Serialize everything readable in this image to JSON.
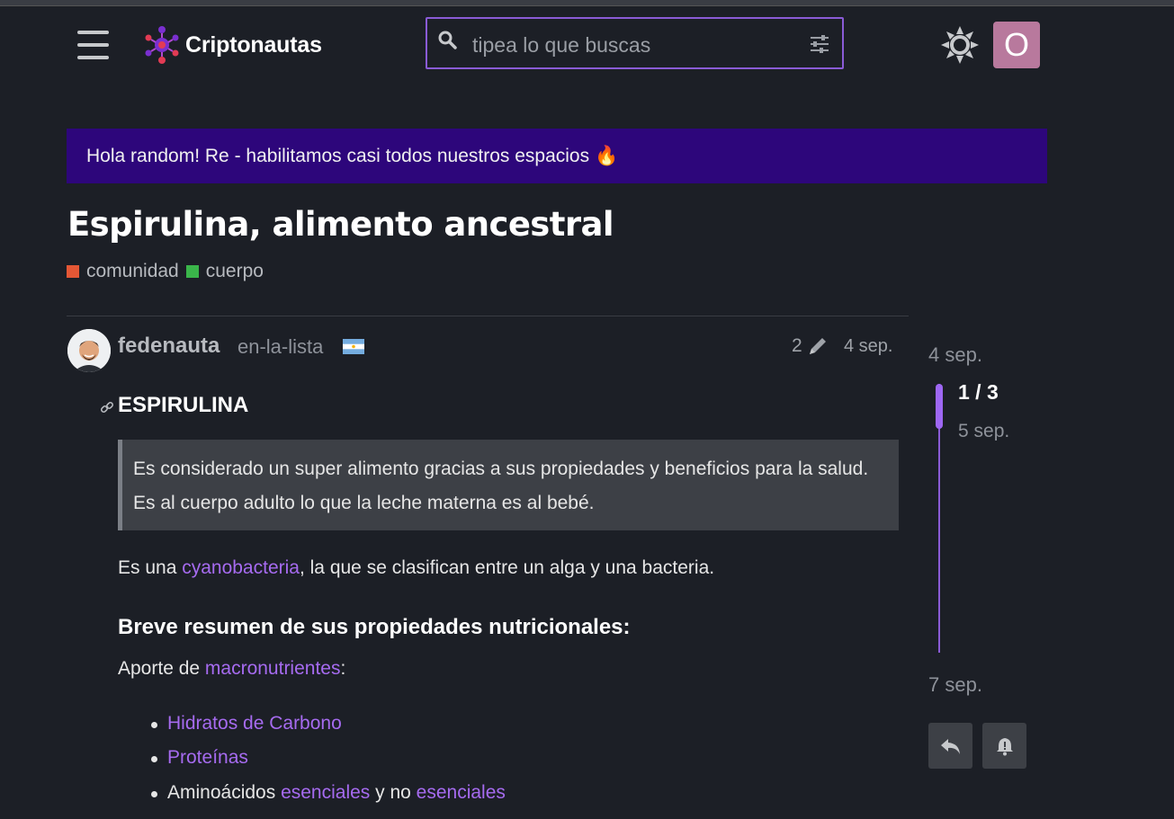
{
  "header": {
    "site_name": "Criptonautas",
    "search_placeholder": "tipea lo que buscas",
    "avatar_letter": "O",
    "avatar_color": "#b8799d",
    "accent_color": "#8a5bd6"
  },
  "banner": {
    "text": "Hola random! Re - habilitamos casi todos nuestros espacios 🔥",
    "background": "#2d067b"
  },
  "topic": {
    "title": "Espirulina, alimento ancestral",
    "categories": [
      {
        "label": "comunidad",
        "color": "#e45735"
      },
      {
        "label": "cuerpo",
        "color": "#3ab54a"
      }
    ]
  },
  "post": {
    "username": "fedenauta",
    "user_title": "en-la-lista",
    "flag": "argentina-flag",
    "edit_count": "2",
    "date": "4 sep.",
    "heading": "ESPIRULINA",
    "quote": "Es considerado un super alimento gracias a sus propiedades y beneficios para la salud. Es al cuerpo adulto lo que la leche materna es al bebé.",
    "p1_before": "Es una ",
    "p1_link": "cyanobacteria",
    "p1_after": ", la que se clasifican entre un alga y una bacteria.",
    "subheading": "Breve resumen de sus propiedades nutricionales:",
    "p2_before": "Aporte de ",
    "p2_link": "macronutrientes",
    "p2_after": ":",
    "list": {
      "item1": "Hidratos de Carbono",
      "item2": "Proteínas",
      "item3_before": "Aminoácidos ",
      "item3_link1": "esenciales",
      "item3_mid": " y no ",
      "item3_link2": "esenciales"
    }
  },
  "timeline": {
    "start_date": "4 sep.",
    "counter": "1 / 3",
    "current_date": "5 sep.",
    "end_date": "7 sep."
  }
}
